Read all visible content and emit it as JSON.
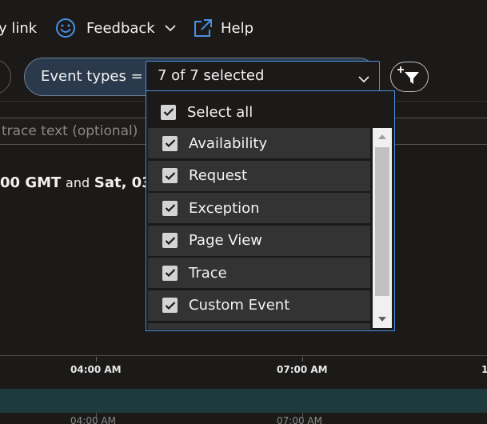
{
  "toolbar": {
    "copy_link_label": "y link",
    "feedback_label": "Feedback",
    "help_label": "Help"
  },
  "filter": {
    "event_types_label": "Event types =",
    "selected_value": "7 of 7 selected"
  },
  "trace_search": {
    "placeholder": "trace text (optional)"
  },
  "time_range": {
    "start": "00 GMT",
    "connector": "and",
    "end": "Sat, 03"
  },
  "dropdown": {
    "select_all_label": "Select all",
    "items": [
      {
        "label": "Availability",
        "checked": true
      },
      {
        "label": "Request",
        "checked": true
      },
      {
        "label": "Exception",
        "checked": true
      },
      {
        "label": "Page View",
        "checked": true
      },
      {
        "label": "Trace",
        "checked": true
      },
      {
        "label": "Custom Event",
        "checked": true
      },
      {
        "label": "",
        "checked": true
      }
    ]
  },
  "chart": {
    "tick_labels": [
      "04:00 AM",
      "07:00 AM",
      "1"
    ],
    "minimap_tick_labels": [
      "04:00 AM",
      "07:00 AM"
    ]
  },
  "colors": {
    "accent": "#4a90e2",
    "pill_bg": "#2a3a4c",
    "band": "#1f3a3d"
  }
}
